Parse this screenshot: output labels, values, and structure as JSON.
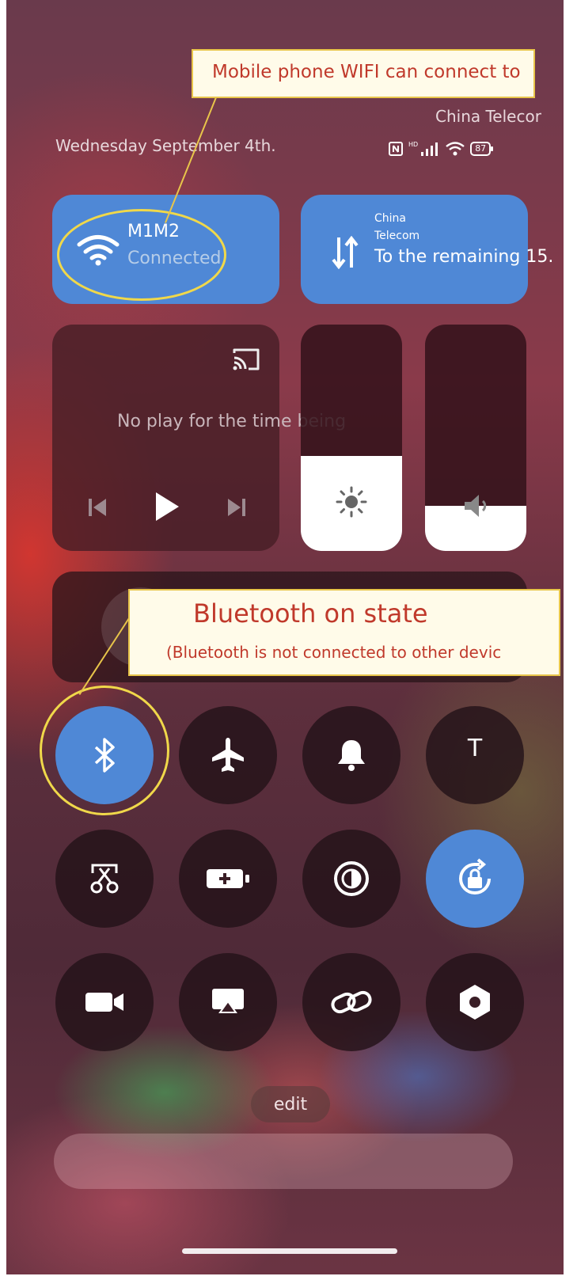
{
  "annotations": {
    "wifi_note": "Mobile phone WIFI can connect to",
    "bluetooth_title": "Bluetooth on state",
    "bluetooth_sub": "(Bluetooth is not connected to other devic"
  },
  "status": {
    "date": "Wednesday September 4th.",
    "carrier": "China Telecor",
    "battery": "87",
    "network_label": "HD"
  },
  "wifi": {
    "name": "M1M2",
    "state": "Connected"
  },
  "mobile_data": {
    "carrier_line1": "China",
    "carrier_line2": "Telecom",
    "remaining": "To the remaining 15."
  },
  "media": {
    "status": "No play for the time being"
  },
  "sliders": {
    "brightness_level": 0.42,
    "volume_level": 0.2
  },
  "toggles": {
    "row1": [
      "bluetooth-icon",
      "airplane-icon",
      "bell-icon",
      "text-t-icon"
    ],
    "row2": [
      "screenshot-scissors-icon",
      "battery-saver-icon",
      "contrast-icon",
      "rotation-lock-icon"
    ],
    "row3": [
      "video-camera-icon",
      "screen-mirror-icon",
      "link-icon",
      "hexagon-settings-icon"
    ],
    "t_label": "T"
  },
  "footer": {
    "edit_label": "edit"
  },
  "colors": {
    "accent_blue": "#4f88d6",
    "annotation_border": "#e8c54a",
    "annotation_text": "#c0392b",
    "annotation_circle": "#f0d84a"
  }
}
